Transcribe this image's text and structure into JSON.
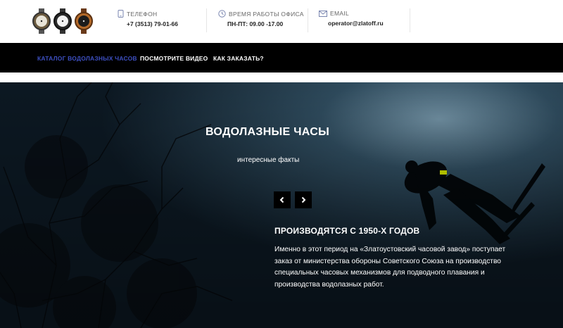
{
  "header": {
    "phone": {
      "label": "ТЕЛЕФОН",
      "value": "+7 (3513) 79-01-66",
      "icon": "phone-icon"
    },
    "hours": {
      "label": "ВРЕМЯ РАБОТЫ ОФИСА",
      "value": "ПН-ПТ: 09.00 -17.00",
      "icon": "clock-icon"
    },
    "email": {
      "label": "EMAIL",
      "value": "operator@zlatoff.ru",
      "icon": "envelope-icon"
    }
  },
  "nav": {
    "items": [
      {
        "label": "КАТАЛОГ ВОДОЛАЗНЫХ ЧАСОВ",
        "active": true
      },
      {
        "label": "ПОСМОТРИТЕ ВИДЕО",
        "active": false
      },
      {
        "label": "КАК ЗАКАЗАТЬ?",
        "active": false
      }
    ]
  },
  "hero": {
    "title": "ВОДОЛАЗНЫЕ ЧАСЫ",
    "subtitle": "интересные факты",
    "fact_title": "ПРОИЗВОДЯТСЯ С 1950-Х ГОДОВ",
    "fact_text": "Именно в этот период на «Златоустовский часовой завод» поступает заказ от министерства обороны Советского Союза на производство специальных часовых механизмов для подводного плавания и производства водолазных работ."
  },
  "colors": {
    "nav_bg": "#000000",
    "nav_active": "#3d4fc0",
    "hero_bg": "#0e1a24"
  }
}
